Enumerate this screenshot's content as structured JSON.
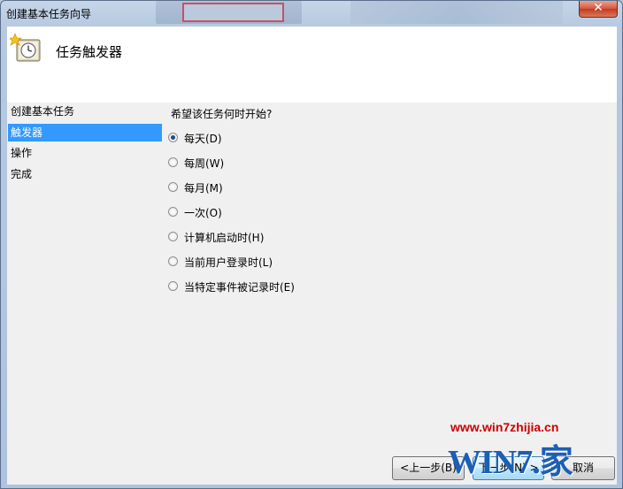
{
  "window": {
    "title": "创建基本任务向导",
    "close_glyph": "✕"
  },
  "header": {
    "title": "任务触发器",
    "icon": "clock-icon"
  },
  "nav": {
    "items": [
      {
        "label": "创建基本任务",
        "active": false
      },
      {
        "label": "触发器",
        "active": true
      },
      {
        "label": "操作",
        "active": false
      },
      {
        "label": "完成",
        "active": false
      }
    ]
  },
  "main": {
    "question": "希望该任务何时开始?",
    "options": [
      {
        "label": "每天(D)",
        "checked": true
      },
      {
        "label": "每周(W)",
        "checked": false
      },
      {
        "label": "每月(M)",
        "checked": false
      },
      {
        "label": "一次(O)",
        "checked": false
      },
      {
        "label": "计算机启动时(H)",
        "checked": false
      },
      {
        "label": "当前用户登录时(L)",
        "checked": false
      },
      {
        "label": "当特定事件被记录时(E)",
        "checked": false
      }
    ]
  },
  "buttons": {
    "back": "<上一步(B)",
    "next": "下一步(N) >",
    "cancel": "取消"
  },
  "watermark": {
    "url": "www.win7zhijia.cn",
    "logo": "WIN7.家"
  },
  "colors": {
    "selection": "#3399ff",
    "header_bg": "#ffffff",
    "content_bg": "#f0f0f0",
    "watermark_url": "#cc0000"
  }
}
